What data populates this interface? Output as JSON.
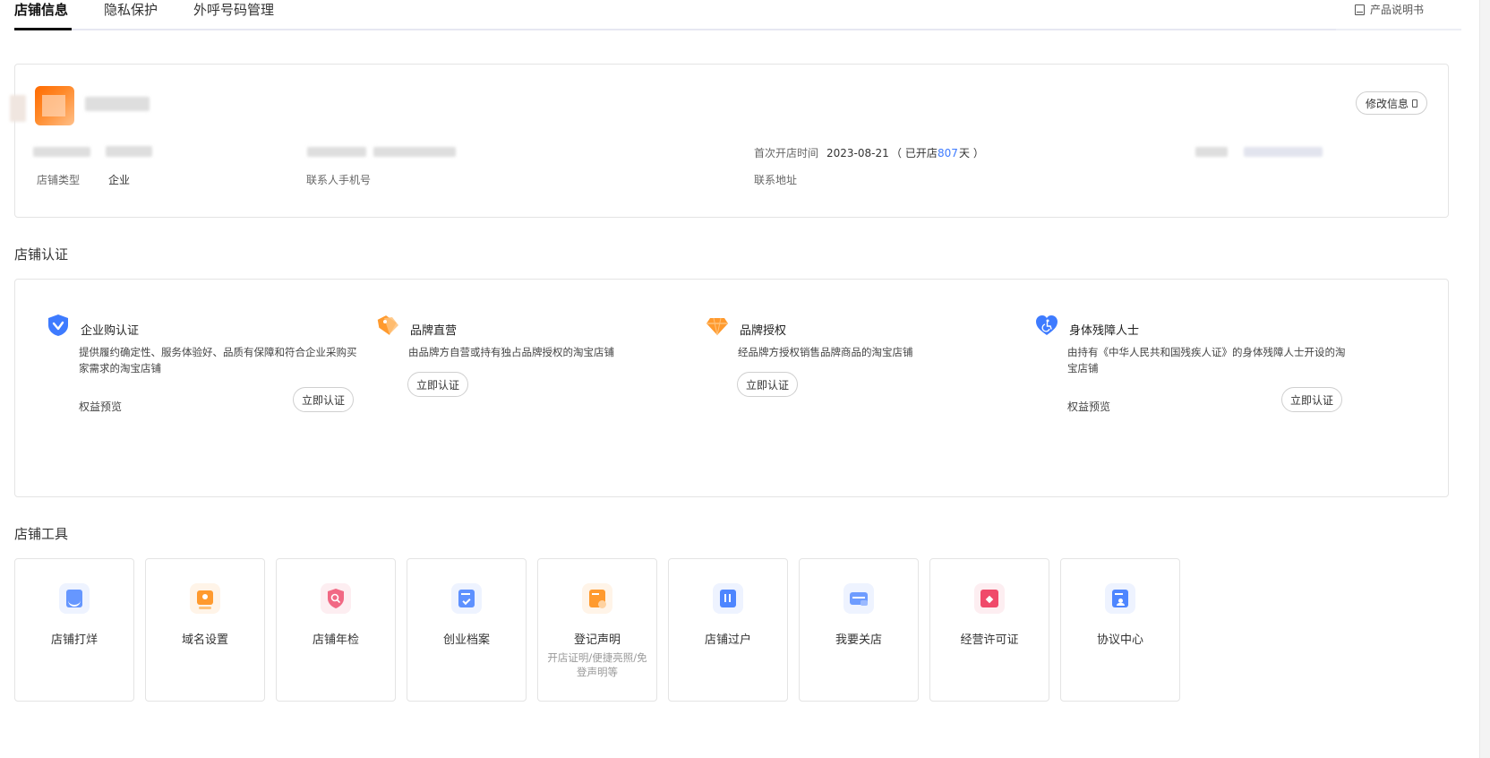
{
  "tabs": [
    {
      "label": "店铺信息",
      "active": true
    },
    {
      "label": "隐私保护",
      "active": false
    },
    {
      "label": "外呼号码管理",
      "active": false
    }
  ],
  "header": {
    "manual_link": "产品说明书"
  },
  "shop_info": {
    "edit_button": "修改信息",
    "open_date_label": "首次开店时间",
    "open_date_value": "2023-08-21",
    "opened_prefix": "（ 已开店 ",
    "opened_days": "807",
    "opened_suffix": "天 ）",
    "shop_type_label": "店铺类型",
    "shop_type_value": "企业",
    "contact_phone_label": "联系人手机号",
    "contact_address_label": "联系地址"
  },
  "certification": {
    "title": "店铺认证",
    "items": [
      {
        "title": "企业购认证",
        "desc": "提供履约确定性、服务体验好、品质有保障和符合企业采购买家需求的淘宝店铺",
        "preview": "权益预览",
        "button": "立即认证",
        "icon": "shield-check-icon",
        "color": "#3e7bff"
      },
      {
        "title": "品牌直营",
        "desc": "由品牌方自营或持有独占品牌授权的淘宝店铺",
        "preview": "",
        "button": "立即认证",
        "icon": "tag-icon",
        "color": "#ff9a2e"
      },
      {
        "title": "品牌授权",
        "desc": "经品牌方授权销售品牌商品的淘宝店铺",
        "preview": "",
        "button": "立即认证",
        "icon": "diamond-icon",
        "color": "#ff9a2e"
      },
      {
        "title": "身体残障人士",
        "desc": "由持有《中华人民共和国残疾人证》的身体残障人士开设的淘宝店铺",
        "preview": "权益预览",
        "button": "立即认证",
        "icon": "heart-accessibility-icon",
        "color": "#3e7bff"
      }
    ]
  },
  "tools": {
    "title": "店铺工具",
    "items": [
      {
        "label": "店铺打烊",
        "sub": "",
        "icon": "shop-close-icon",
        "color": "#4e86ff"
      },
      {
        "label": "域名设置",
        "sub": "",
        "icon": "domain-icon",
        "color": "#ff9a2e"
      },
      {
        "label": "店铺年检",
        "sub": "",
        "icon": "shield-search-icon",
        "color": "#f05a78"
      },
      {
        "label": "创业档案",
        "sub": "",
        "icon": "archive-icon",
        "color": "#4e86ff"
      },
      {
        "label": "登记声明",
        "sub": "开店证明/便捷亮照/免登声明等",
        "icon": "declaration-icon",
        "color": "#ff9a2e"
      },
      {
        "label": "店铺过户",
        "sub": "",
        "icon": "transfer-icon",
        "color": "#4e86ff"
      },
      {
        "label": "我要关店",
        "sub": "",
        "icon": "close-shop-icon",
        "color": "#4e86ff"
      },
      {
        "label": "经营许可证",
        "sub": "",
        "icon": "license-icon",
        "color": "#f04a6a"
      },
      {
        "label": "协议中心",
        "sub": "",
        "icon": "agreement-icon",
        "color": "#4e86ff"
      }
    ]
  }
}
